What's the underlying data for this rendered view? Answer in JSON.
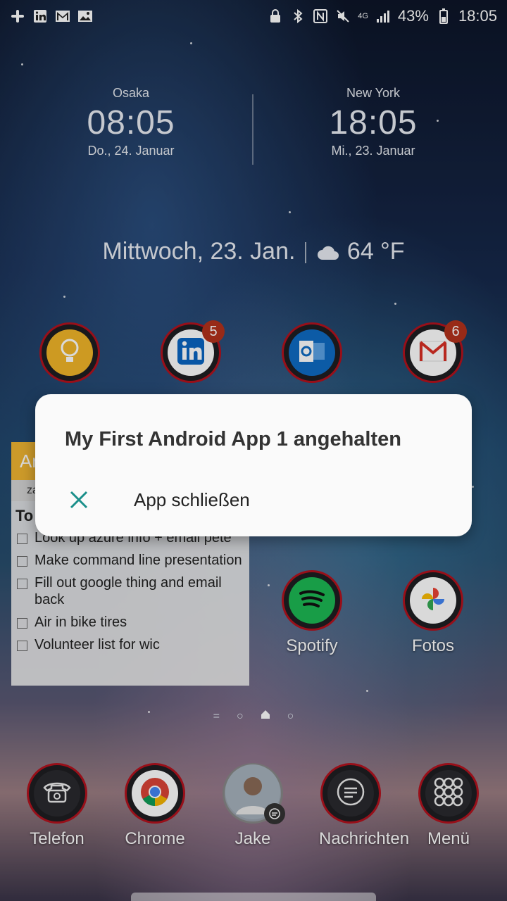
{
  "status_bar": {
    "battery_percent": "43%",
    "time": "18:05",
    "network": "4G",
    "left_icons": [
      "slack-icon",
      "linkedin-icon",
      "gmail-icon",
      "gallery-icon"
    ],
    "right_icons": [
      "lock-icon",
      "bluetooth-icon",
      "nfc-icon",
      "mute-icon",
      "signal-icon",
      "battery-icon"
    ]
  },
  "clocks": [
    {
      "city": "Osaka",
      "time": "08:05",
      "date": "Do., 24. Januar"
    },
    {
      "city": "New York",
      "time": "18:05",
      "date": "Mi., 23. Januar"
    }
  ],
  "weather": {
    "date": "Mittwoch, 23. Jan.",
    "temperature": "64 °F"
  },
  "top_apps": [
    {
      "name": "keep",
      "badge": ""
    },
    {
      "name": "linkedin",
      "badge": "5"
    },
    {
      "name": "outlook",
      "badge": ""
    },
    {
      "name": "gmail",
      "badge": "6"
    }
  ],
  "mid_apps": [
    {
      "label": "Spotify"
    },
    {
      "label": "Fotos"
    }
  ],
  "widget": {
    "header": "Ar",
    "subheader": "za",
    "title": "To",
    "items": [
      "Look up azure info + email pete",
      "Make command line presentation",
      "Fill out google thing and email back",
      "Air in bike tires",
      "Volunteer list for wic"
    ]
  },
  "dock": [
    {
      "label": "Telefon"
    },
    {
      "label": "Chrome"
    },
    {
      "label": "Jake"
    },
    {
      "label": "Nachrichten"
    },
    {
      "label": "Menü"
    }
  ],
  "dialog": {
    "title": "My First Android App 1 angehalten",
    "action_label": "App schließen",
    "accent": "#1a8f8a"
  }
}
